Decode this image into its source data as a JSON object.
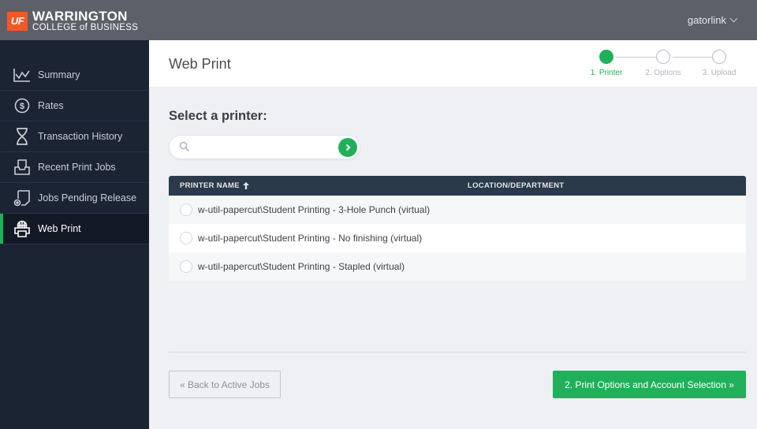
{
  "header": {
    "logo_badge": "UF",
    "logo_line1": "WARRINGTON",
    "logo_line2": "COLLEGE of BUSINESS",
    "user_label": "gatorlink",
    "user_menu_icon": "chevron-down-icon"
  },
  "sidebar": {
    "items": [
      {
        "label": "Summary",
        "icon": "line-chart-icon",
        "active": false
      },
      {
        "label": "Rates",
        "icon": "dollar-circle-icon",
        "active": false
      },
      {
        "label": "Transaction History",
        "icon": "hourglass-icon",
        "active": false
      },
      {
        "label": "Recent Print Jobs",
        "icon": "printer-tray-icon",
        "active": false
      },
      {
        "label": "Jobs Pending Release",
        "icon": "pending-document-icon",
        "active": false
      },
      {
        "label": "Web Print",
        "icon": "web-printer-icon",
        "active": true
      }
    ]
  },
  "page": {
    "title": "Web Print",
    "steps": [
      {
        "label": "1. Printer",
        "active": true
      },
      {
        "label": "2. Options",
        "active": false
      },
      {
        "label": "3. Upload",
        "active": false
      }
    ],
    "section_title": "Select a printer:",
    "search": {
      "value": "",
      "placeholder": ""
    },
    "table": {
      "columns": [
        "PRINTER NAME",
        "LOCATION/DEPARTMENT"
      ],
      "sort_column": "PRINTER NAME",
      "sort_icon": "arrow-up-icon",
      "rows": [
        {
          "name": "w-util-papercut\\Student Printing - 3-Hole Punch (virtual)",
          "location": ""
        },
        {
          "name": "w-util-papercut\\Student Printing - No finishing (virtual)",
          "location": ""
        },
        {
          "name": "w-util-papercut\\Student Printing - Stapled (virtual)",
          "location": ""
        }
      ]
    },
    "back_button": "« Back to Active Jobs",
    "next_button": "2. Print Options and Account Selection »"
  },
  "colors": {
    "accent": "#21b05a",
    "topbar": "#5d5f69",
    "sidebar": "#1b2433",
    "table_header": "#2b3a4a",
    "uf_orange": "#f1582a"
  }
}
